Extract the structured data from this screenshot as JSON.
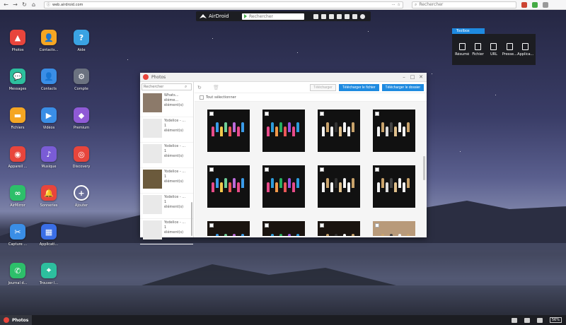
{
  "browser": {
    "url": "web.airdroid.com",
    "search_placeholder": "Rechercher"
  },
  "airdroid_bar": {
    "brand": "AirDroid",
    "search_placeholder": "Rechercher"
  },
  "toolbox": {
    "title": "Toolbox",
    "tools": [
      {
        "label": "Résumé",
        "icon": "phone-icon"
      },
      {
        "label": "Fichier",
        "icon": "file-icon"
      },
      {
        "label": "URL",
        "icon": "globe-icon"
      },
      {
        "label": "Presse...",
        "icon": "clipboard-icon"
      },
      {
        "label": "Applica...",
        "icon": "app-icon"
      }
    ]
  },
  "desktop_icons": [
    {
      "label": "Photos",
      "color": "#e8453c",
      "glyph": "▲",
      "icon": "photos-icon"
    },
    {
      "label": "Contacts...",
      "color": "#f5a623",
      "glyph": "👤",
      "icon": "contacts-icon"
    },
    {
      "label": "Aide",
      "color": "#3aa3e3",
      "glyph": "?",
      "icon": "help-icon"
    },
    {
      "label": "Messages",
      "color": "#2dbf9e",
      "glyph": "💬",
      "icon": "messages-icon"
    },
    {
      "label": "Contacts",
      "color": "#3a8ee6",
      "glyph": "👤",
      "icon": "contacts-book-icon"
    },
    {
      "label": "Compte",
      "color": "#6b7280",
      "glyph": "⚙",
      "icon": "account-icon"
    },
    {
      "label": "Fichiers",
      "color": "#f5a623",
      "glyph": "▬",
      "icon": "files-icon"
    },
    {
      "label": "Vidéos",
      "color": "#3a8ee6",
      "glyph": "▶",
      "icon": "videos-icon"
    },
    {
      "label": "Premium",
      "color": "#8f5ad6",
      "glyph": "◆",
      "icon": "premium-icon"
    },
    {
      "label": "Appareil ...",
      "color": "#e8453c",
      "glyph": "◉",
      "icon": "camera-icon"
    },
    {
      "label": "Musique",
      "color": "#7a5cd6",
      "glyph": "♪",
      "icon": "music-icon"
    },
    {
      "label": "Discovery",
      "color": "#e8453c",
      "glyph": "◎",
      "icon": "discovery-icon"
    },
    {
      "label": "AirMirror",
      "color": "#2dbf6a",
      "glyph": "∞",
      "icon": "airmirror-icon"
    },
    {
      "label": "Sonneries",
      "color": "#e8453c",
      "glyph": "🔔",
      "icon": "ringtone-icon"
    },
    {
      "label": "Ajouter",
      "color": "transparent",
      "glyph": "+",
      "icon": "add-icon"
    },
    {
      "label": "Capture ...",
      "color": "#3a8ee6",
      "glyph": "✂",
      "icon": "screenshot-icon"
    },
    {
      "label": "Applicati...",
      "color": "#3a6ee6",
      "glyph": "▦",
      "icon": "apps-icon"
    },
    {
      "label": "Journal d...",
      "color": "#2dbf6a",
      "glyph": "✆",
      "icon": "calllog-icon"
    },
    {
      "label": "Trouver l...",
      "color": "#2dbf9e",
      "glyph": "⌖",
      "icon": "findphone-icon"
    }
  ],
  "photos_window": {
    "title": "Photos",
    "search_placeholder": "Rechercher",
    "select_all_label": "Tout sélectionner",
    "buttons": {
      "download": "Télécharger",
      "download_file": "Télécharger le fichier",
      "download_folder": "Télécharger le dossier"
    },
    "albums": [
      {
        "line1": "Whats...",
        "line2": "éléme...",
        "line3": "élément(s)"
      },
      {
        "line1": "Yodelice - ...",
        "line2": "1",
        "line3": "élément(s)"
      },
      {
        "line1": "Yodelice - ...",
        "line2": "1",
        "line3": "élément(s)"
      },
      {
        "line1": "Yodelice - ...",
        "line2": "1",
        "line3": "élément(s)"
      },
      {
        "line1": "Yodelice - ...",
        "line2": "1",
        "line3": "élément(s)"
      },
      {
        "line1": "Yodelice - ...",
        "line2": "1",
        "line3": "élément(s)"
      }
    ]
  },
  "taskbar": {
    "app_label": "Photos",
    "battery": "56%"
  }
}
